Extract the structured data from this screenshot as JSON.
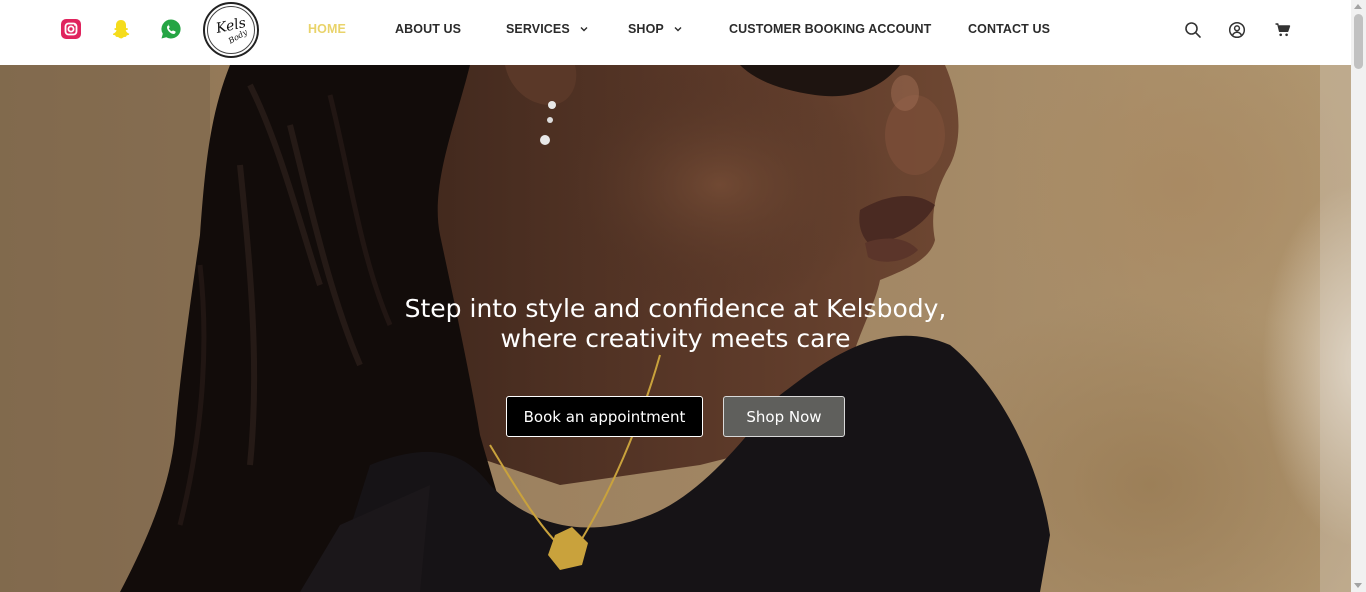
{
  "header": {
    "social": [
      {
        "name": "instagram-icon",
        "color": "#e0245e"
      },
      {
        "name": "snapchat-icon",
        "color": "#f5dc1c"
      },
      {
        "name": "whatsapp-icon",
        "color": "#25a544"
      }
    ],
    "logo": {
      "line1": "Kels",
      "line2": "Body"
    },
    "nav": {
      "home": "HOME",
      "about": "ABOUT US",
      "services": "SERVICES",
      "shop": "SHOP",
      "booking": "CUSTOMER BOOKING ACCOUNT",
      "contact": "CONTACT US"
    },
    "active_color": "#e9d36a",
    "icons": [
      "search-icon",
      "account-icon",
      "cart-icon"
    ]
  },
  "hero": {
    "title_line1": "Step into style and confidence at Kelsbody,",
    "title_line2": "where creativity meets care",
    "book_button": "Book an appointment",
    "shop_button": "Shop Now"
  }
}
